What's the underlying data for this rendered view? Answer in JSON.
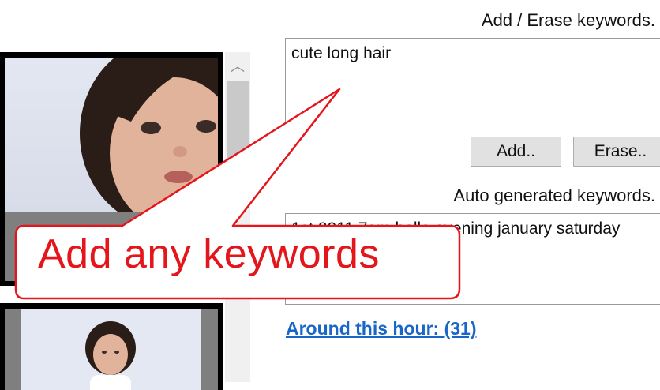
{
  "keywords_panel": {
    "add_label": "Add / Erase keywords.",
    "keywords_value": "cute long hair",
    "add_button": "Add..",
    "erase_button": "Erase..",
    "auto_label": "Auto generated keywords.",
    "auto_value": "1st 2011 7am hello evening january saturday"
  },
  "link": {
    "text": "Around this hour: (31)"
  },
  "callout": {
    "text": "Add any keywords"
  },
  "thumbnails": {
    "scroll_up_icon": "chevron-up-icon"
  },
  "colors": {
    "callout_red": "#e4151b",
    "link_blue": "#1a66c8"
  }
}
